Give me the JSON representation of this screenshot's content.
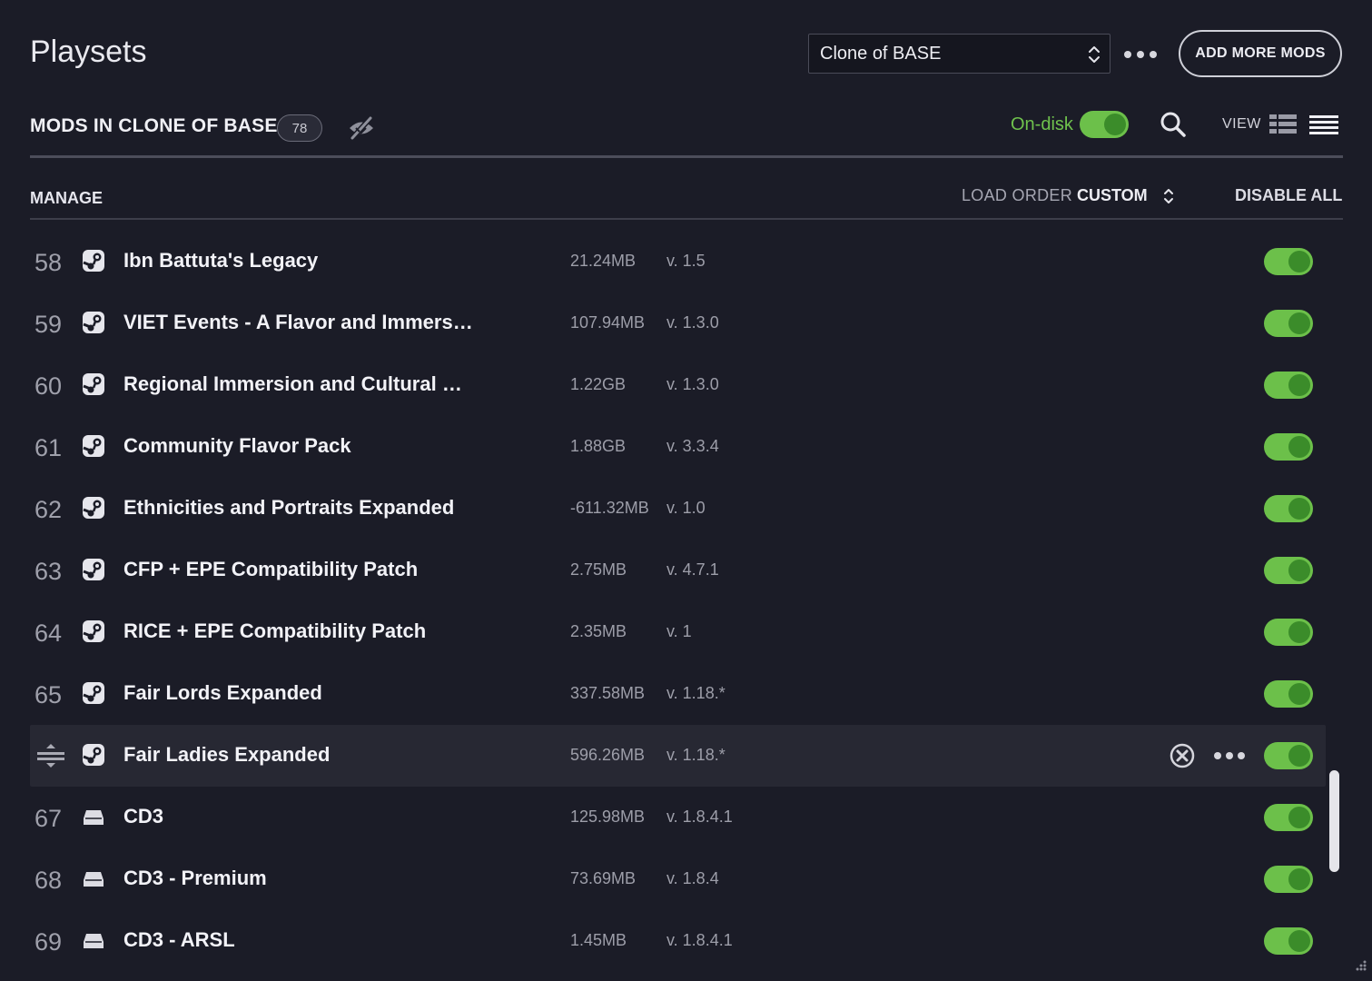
{
  "header": {
    "title": "Playsets",
    "playset_select": "Clone of BASE",
    "add_button": "ADD MORE MODS"
  },
  "toolbar": {
    "heading": "MODS IN CLONE OF BASE",
    "count": "78",
    "ondisk_label": "On-disk",
    "ondisk_enabled": true,
    "view_label": "VIEW"
  },
  "manage_bar": {
    "manage_label": "MANAGE",
    "load_order_label": "LOAD ORDER",
    "load_order_value": "CUSTOM",
    "disable_all": "DISABLE ALL"
  },
  "colors": {
    "accent_green": "#6cc04a",
    "background": "#1b1c27"
  },
  "mods": [
    {
      "num": "58",
      "source": "steam-icon",
      "name": "Ibn Battuta's Legacy",
      "size": "21.24MB",
      "version": "v. 1.5",
      "enabled": true
    },
    {
      "num": "59",
      "source": "steam-icon",
      "name": "VIET Events - A Flavor and Immers…",
      "size": "107.94MB",
      "version": "v. 1.3.0",
      "enabled": true
    },
    {
      "num": "60",
      "source": "steam-icon",
      "name": "Regional Immersion and Cultural …",
      "size": "1.22GB",
      "version": "v. 1.3.0",
      "enabled": true
    },
    {
      "num": "61",
      "source": "steam-icon",
      "name": "Community Flavor Pack",
      "size": "1.88GB",
      "version": "v. 3.3.4",
      "enabled": true
    },
    {
      "num": "62",
      "source": "steam-icon",
      "name": "Ethnicities and Portraits Expanded",
      "size": "-611.32MB",
      "version": "v. 1.0",
      "enabled": true
    },
    {
      "num": "63",
      "source": "steam-icon",
      "name": "CFP + EPE Compatibility Patch",
      "size": "2.75MB",
      "version": "v. 4.7.1",
      "enabled": true
    },
    {
      "num": "64",
      "source": "steam-icon",
      "name": "RICE + EPE Compatibility Patch",
      "size": "2.35MB",
      "version": "v. 1",
      "enabled": true
    },
    {
      "num": "65",
      "source": "steam-icon",
      "name": "Fair Lords Expanded",
      "size": "337.58MB",
      "version": "v. 1.18.*",
      "enabled": true
    },
    {
      "num": "",
      "source": "steam-icon",
      "name": "Fair Ladies Expanded",
      "size": "596.26MB",
      "version": "v. 1.18.*",
      "enabled": true,
      "selected": true
    },
    {
      "num": "67",
      "source": "local-drive-icon",
      "name": "CD3",
      "size": "125.98MB",
      "version": "v. 1.8.4.1",
      "enabled": true
    },
    {
      "num": "68",
      "source": "local-drive-icon",
      "name": "CD3 - Premium",
      "size": "73.69MB",
      "version": "v. 1.8.4",
      "enabled": true
    },
    {
      "num": "69",
      "source": "local-drive-icon",
      "name": "CD3 - ARSL",
      "size": "1.45MB",
      "version": "v. 1.8.4.1",
      "enabled": true
    }
  ]
}
